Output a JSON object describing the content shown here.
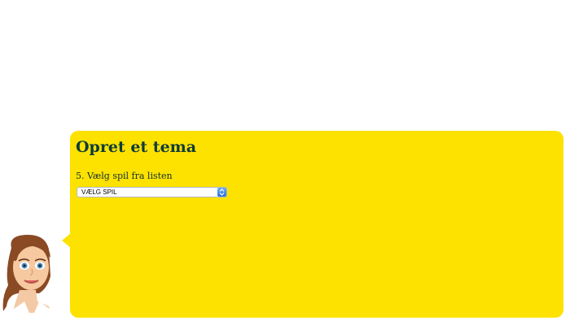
{
  "panel": {
    "title": "Opret et tema",
    "step_label": "5. Vælg spil fra listen",
    "game_select": {
      "selected": "VÆLG SPIL"
    }
  },
  "colors": {
    "panel_background": "#fde200",
    "title_text": "#0f3b3a",
    "select_arrow": "#2a6fd6"
  },
  "icons": {
    "select_arrows": "chevron-up-down-icon",
    "assistant": "assistant-avatar"
  }
}
